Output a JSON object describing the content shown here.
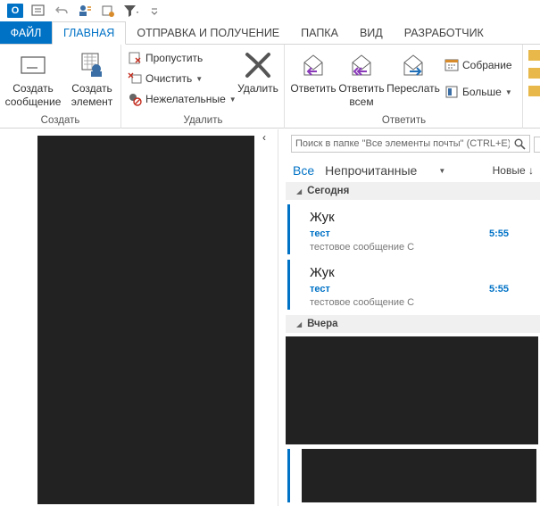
{
  "qat": {
    "logo": "O"
  },
  "tabs": [
    {
      "label": "ФАЙЛ"
    },
    {
      "label": "ГЛАВНАЯ"
    },
    {
      "label": "ОТПРАВКА И ПОЛУЧЕНИЕ"
    },
    {
      "label": "ПАПКА"
    },
    {
      "label": "ВИД"
    },
    {
      "label": "РАЗРАБОТЧИК"
    }
  ],
  "ribbon": {
    "create": {
      "label": "Создать",
      "new_message": "Создать сообщение",
      "new_item": "Создать элемент"
    },
    "delete": {
      "label": "Удалить",
      "ignore": "Пропустить",
      "clean": "Очистить",
      "junk": "Нежелательные",
      "delete_btn": "Удалить"
    },
    "respond": {
      "label": "Ответить",
      "reply": "Ответить",
      "reply_all": "Ответить всем",
      "forward": "Переслать",
      "meeting": "Собрание",
      "more": "Больше"
    }
  },
  "list": {
    "search_placeholder": "Поиск в папке \"Все элементы почты\" (CTRL+E)",
    "filter_all": "Все",
    "filter_unread": "Непрочитанные",
    "sort": "Новые",
    "groups": [
      {
        "label": "Сегодня"
      },
      {
        "label": "Вчера"
      }
    ],
    "messages": [
      {
        "from": "Жук",
        "subject": "тест",
        "preview": "тестовое сообщение  С",
        "time": "5:55"
      },
      {
        "from": "Жук",
        "subject": "тест",
        "preview": "тестовое сообщение  С",
        "time": "5:55"
      }
    ]
  },
  "colors": {
    "accent": "#0072c6",
    "redaction": "#222222"
  }
}
